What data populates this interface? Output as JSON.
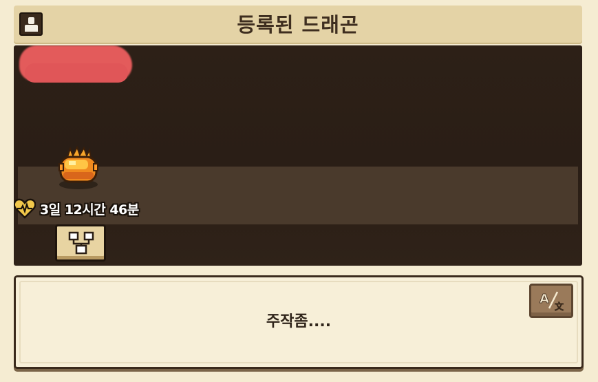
{
  "header": {
    "title": "등록된 드래곤",
    "profile_icon": "profile-icon"
  },
  "pen": {
    "owner_name_redacted": true,
    "dragon": {
      "icon": "fire-dragon-egg-icon",
      "timer_icon": "heart-pulse-icon",
      "timer": "3일 12시간 46분"
    },
    "tree_button_icon": "family-tree-icon"
  },
  "message": {
    "text": "주작좀....",
    "translate_icon": "translate-icon",
    "translate_glyph": "A",
    "translate_glyph2": "文"
  },
  "colors": {
    "background": "#f5ecd2",
    "header": "#e4d3a6",
    "pen_dark": "#2d2017",
    "pen_strip": "#4a3a2c",
    "heart_gold": "#f2c84b",
    "redaction": "#e35b5b"
  }
}
